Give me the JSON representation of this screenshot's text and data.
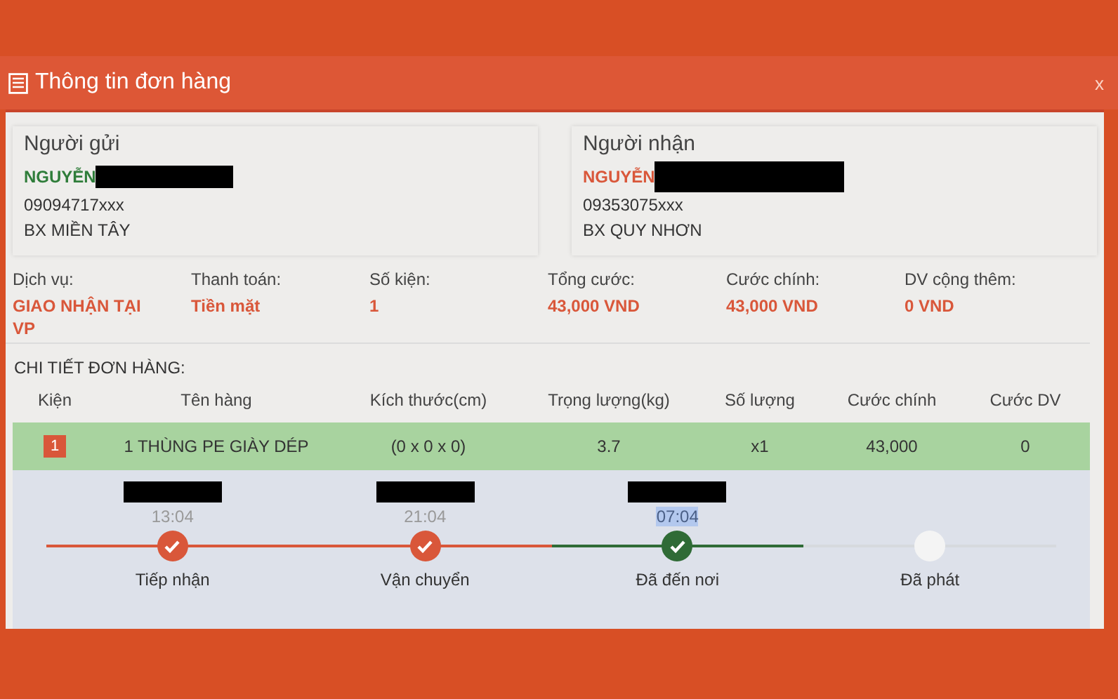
{
  "window": {
    "title": "Thông tin đơn hàng",
    "close": "x"
  },
  "parties": [
    {
      "heading": "Người gửi",
      "name": "NGUYỄN",
      "color": "#2f7d3a",
      "redacted": true,
      "phone": "09094717xxx",
      "address": "BX MIỀN TÂY"
    },
    {
      "heading": "Người nhận",
      "name": "NGUYỄN",
      "color": "#d9573a",
      "redacted": true,
      "phone": "09353075xxx",
      "address": "BX QUY NHƠN"
    }
  ],
  "summary": [
    {
      "label": "Dịch vụ:",
      "value": "GIAO NHẬN TẠI VP"
    },
    {
      "label": "Thanh toán:",
      "value": "Tiền mặt"
    },
    {
      "label": "Số kiện:",
      "value": "1"
    },
    {
      "label": "Tổng cước:",
      "value": "43,000 VND"
    },
    {
      "label": "Cước chính:",
      "value": "43,000 VND"
    },
    {
      "label": "DV cộng thêm:",
      "value": "0 VND"
    }
  ],
  "details": {
    "title": "CHI TIẾT ĐƠN HÀNG:",
    "columns": [
      "Kiện",
      "Tên hàng",
      "Kích thước(cm)",
      "Trọng lượng(kg)",
      "Số lượng",
      "Cước chính",
      "Cước DV"
    ],
    "rows": [
      {
        "cells": [
          "1",
          "1 THÙNG PE GIÀY DÉP",
          "(0 x 0 x 0)",
          "3.7",
          "x1",
          "43,000",
          "0"
        ]
      }
    ]
  },
  "tracking": [
    {
      "label": "Tiếp nhận",
      "time": "13:04",
      "redacted": true,
      "highlighted": false,
      "kind": "done"
    },
    {
      "label": "Vận chuyển",
      "time": "21:04",
      "redacted": true,
      "highlighted": false,
      "kind": "done"
    },
    {
      "label": "Đã đến nơi",
      "time": "07:04",
      "redacted": true,
      "highlighted": true,
      "kind": "current"
    },
    {
      "label": "Đã phát",
      "kind": "pending"
    }
  ]
}
